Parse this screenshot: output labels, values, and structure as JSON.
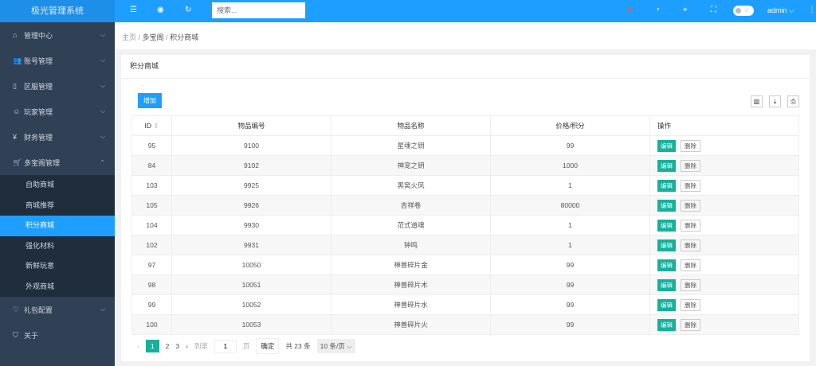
{
  "app": {
    "title": "极光管理系统"
  },
  "topbar": {
    "search_placeholder": "搜索...",
    "user": "admin",
    "user_chevron": "⌵",
    "more": "⋮"
  },
  "sidebar": {
    "items": [
      {
        "label": "管理中心",
        "icon": "⌂"
      },
      {
        "label": "账号管理",
        "icon": "👥"
      },
      {
        "label": "区服管理",
        "icon": "▯"
      },
      {
        "label": "玩家管理",
        "icon": "☺"
      },
      {
        "label": "财务管理",
        "icon": "¥"
      },
      {
        "label": "多宝阁管理",
        "icon": "🛒"
      }
    ],
    "sub_items": [
      "自助商城",
      "商城推荐",
      "积分商城",
      "强化材料",
      "新鲜玩意",
      "外观商城"
    ],
    "bottom_items": [
      {
        "label": "礼包配置",
        "icon": "♡"
      },
      {
        "label": "关于",
        "icon": "⛉"
      }
    ]
  },
  "breadcrumb": [
    "主页",
    "多宝阁",
    "积分商城"
  ],
  "card": {
    "title": "积分商城",
    "add_label": "增加"
  },
  "table": {
    "headers": [
      "ID",
      "物品编号",
      "物品名称",
      "价格/积分",
      "操作"
    ],
    "rows": [
      [
        "95",
        "9100",
        "星魂之钥",
        "99"
      ],
      [
        "84",
        "9102",
        "神宠之钥",
        "1000"
      ],
      [
        "103",
        "9925",
        "黑窝火凤",
        "1"
      ],
      [
        "105",
        "9926",
        "吉祥卷",
        "80000"
      ],
      [
        "104",
        "9930",
        "范式道魂",
        "1"
      ],
      [
        "102",
        "9931",
        "钟鸣",
        "1"
      ],
      [
        "97",
        "10050",
        "神兽碎片金",
        "99"
      ],
      [
        "98",
        "10051",
        "神兽碎片木",
        "99"
      ],
      [
        "99",
        "10052",
        "神兽碎片水",
        "99"
      ],
      [
        "100",
        "10053",
        "神兽碎片火",
        "99"
      ]
    ],
    "edit_label": "编辑",
    "delete_label": "删除"
  },
  "pager": {
    "prev": "‹",
    "pages": [
      "1",
      "2",
      "3"
    ],
    "next": "›",
    "goto": "到第",
    "page_input": "1",
    "page_unit": "页",
    "confirm": "确定",
    "total": "共 23 条",
    "page_size": "10 条/页"
  }
}
